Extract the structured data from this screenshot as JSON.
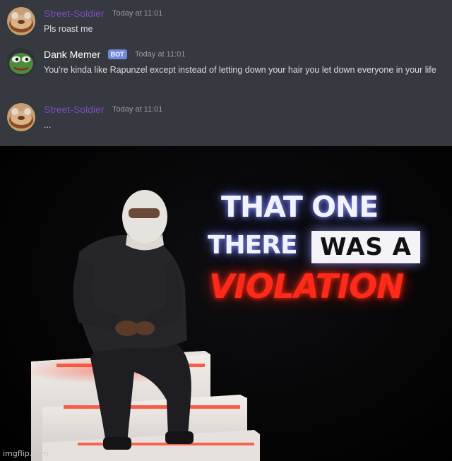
{
  "chat": {
    "messages": [
      {
        "username": "Street-Soldier",
        "timestamp": "Today at 11:01",
        "text": "Pls roast me",
        "avatar_icon": "donut-avatar"
      },
      {
        "username": "Dank Memer",
        "badge": "BOT",
        "timestamp": "Today at 11:01",
        "text": "You're kinda like Rapunzel except instead of letting down your hair you let down everyone in your life",
        "avatar_icon": "pepe-frog-avatar"
      },
      {
        "username": "Street-Soldier",
        "timestamp": "Today at 11:01",
        "text": "...",
        "avatar_icon": "donut-avatar"
      }
    ]
  },
  "meme": {
    "caption_line1": "THAT ONE",
    "caption_line2": "THERE",
    "caption_boxed": "WAS A",
    "caption_line3": "VIOLATION"
  },
  "watermark": "imgflip.com",
  "colors": {
    "chat_background": "#36393f",
    "soldier_name": "#7a4fbf",
    "bot_badge": "#7289da",
    "violation_red": "#ff2a1a"
  }
}
